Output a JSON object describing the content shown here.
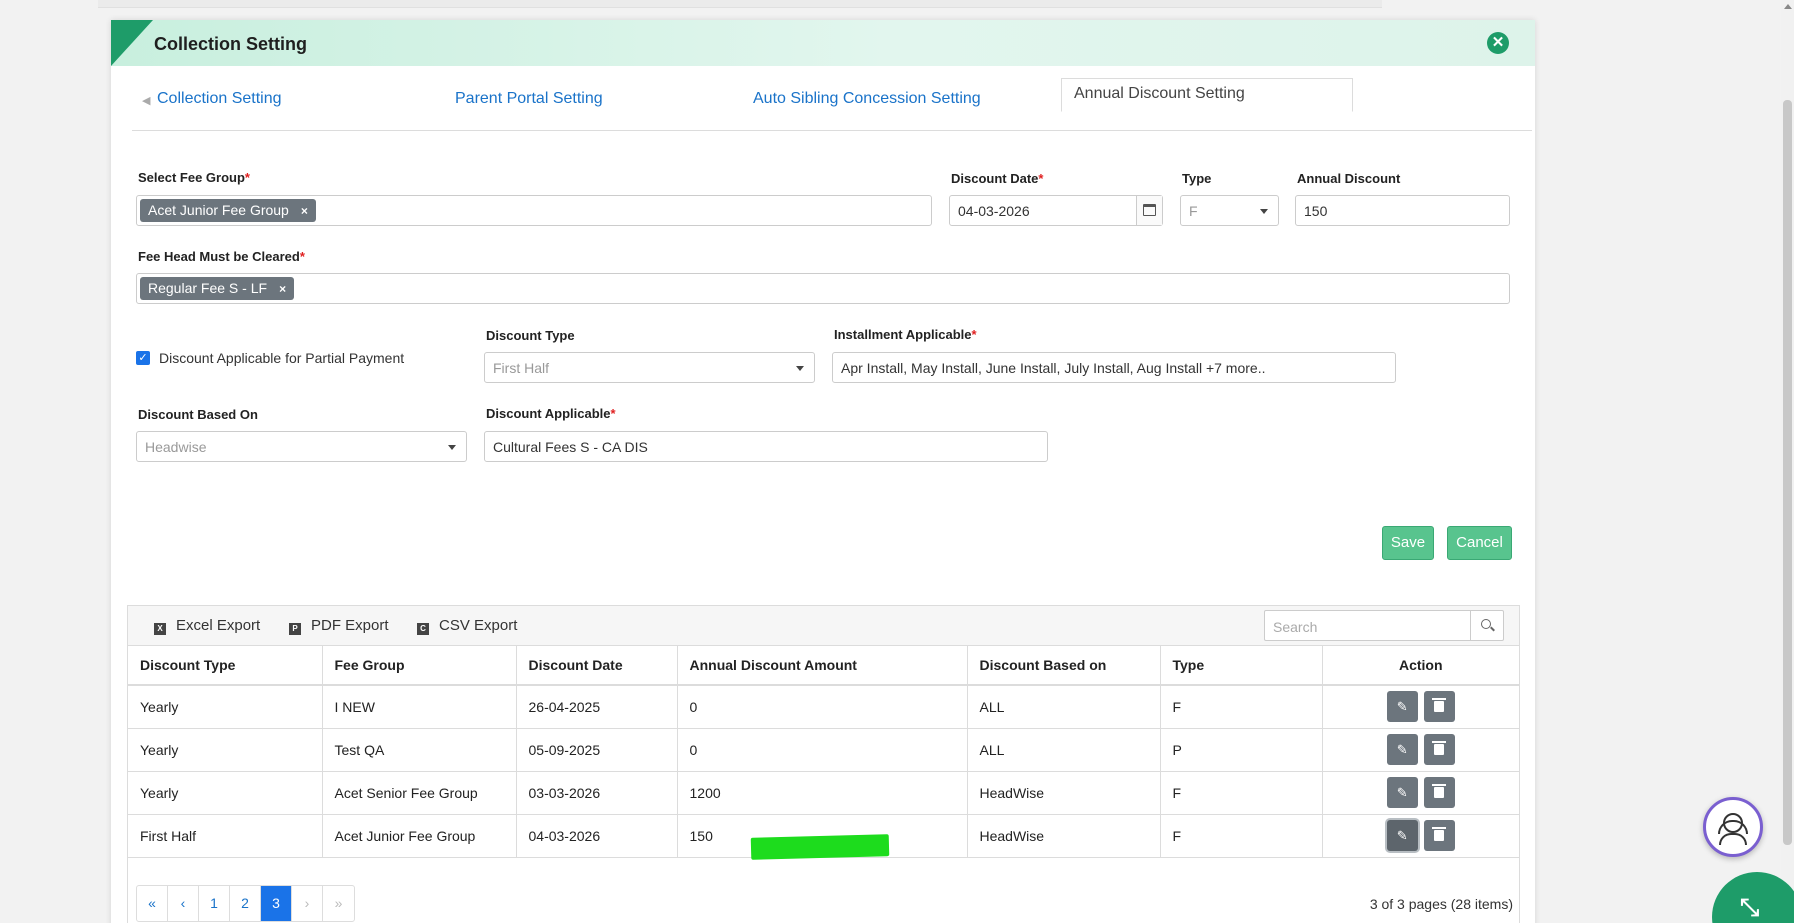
{
  "modal": {
    "title": "Collection Setting",
    "close_icon": "close-circle-icon"
  },
  "tabs": [
    {
      "label": "Collection Setting",
      "active": false
    },
    {
      "label": "Parent Portal Setting",
      "active": false
    },
    {
      "label": "Auto Sibling Concession Setting",
      "active": false
    },
    {
      "label": "Annual Discount Setting",
      "active": true
    }
  ],
  "form": {
    "fee_group": {
      "label": "Select Fee Group",
      "required": "*",
      "chip": "Acet Junior Fee Group",
      "chip_remove": "×"
    },
    "discount_date": {
      "label": "Discount Date",
      "required": "*",
      "value": "04-03-2026"
    },
    "type": {
      "label": "Type",
      "value": "F"
    },
    "annual_discount": {
      "label": "Annual Discount",
      "value": "150"
    },
    "fee_head_cleared": {
      "label": "Fee Head Must be Cleared",
      "required": "*",
      "chip": "Regular Fee S - LF",
      "chip_remove": "×"
    },
    "partial_payment": {
      "label": "Discount Applicable for Partial Payment",
      "checked": true,
      "check": "✓"
    },
    "discount_type": {
      "label": "Discount Type",
      "value": "First Half"
    },
    "installment_applicable": {
      "label": "Installment Applicable",
      "required": "*",
      "value": "Apr Install, May Install, June Install, July Install, Aug Install  +7 more.."
    },
    "discount_based_on": {
      "label": "Discount Based On",
      "value": "Headwise"
    },
    "discount_applicable": {
      "label": "Discount Applicable",
      "required": "*",
      "value": "Cultural Fees S - CA DIS"
    }
  },
  "buttons": {
    "save": "Save",
    "cancel": "Cancel"
  },
  "toolbar": {
    "excel": "Excel Export",
    "pdf": "PDF Export",
    "csv": "CSV Export",
    "search_placeholder": "Search"
  },
  "table": {
    "headers": [
      "Discount Type",
      "Fee Group",
      "Discount Date",
      "Annual Discount Amount",
      "Discount Based on",
      "Type",
      "Action"
    ],
    "rows": [
      [
        "Yearly",
        "I NEW",
        "26-04-2025",
        "0",
        "ALL",
        "F"
      ],
      [
        "Yearly",
        "Test QA",
        "05-09-2025",
        "0",
        "ALL",
        "P"
      ],
      [
        "Yearly",
        "Acet Senior Fee Group",
        "03-03-2026",
        "1200",
        "HeadWise",
        "F"
      ],
      [
        "First Half",
        "Acet Junior Fee Group",
        "04-03-2026",
        "150",
        "HeadWise",
        "F"
      ]
    ]
  },
  "pager": {
    "first": "«",
    "prev": "‹",
    "pages": [
      "1",
      "2",
      "3"
    ],
    "current": "3",
    "next": "›",
    "last": "»",
    "info": "3 of 3 pages (28 items)"
  },
  "colors": {
    "accent": "#1e9c69",
    "link": "#1a73c9",
    "save": "#58c48e",
    "marker": "#1ddc1d"
  }
}
